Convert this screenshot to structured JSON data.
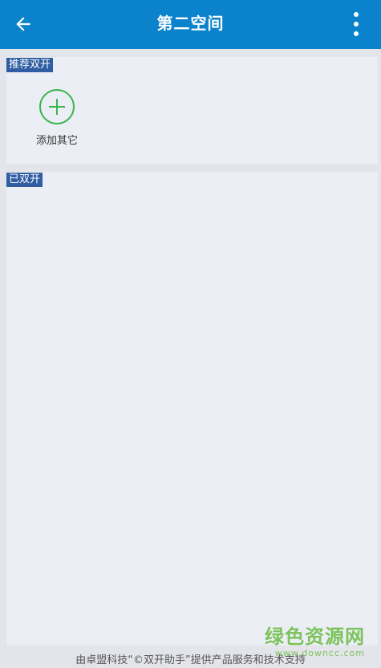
{
  "header": {
    "title": "第二空间",
    "back_icon": "arrow-left-icon",
    "menu_icon": "more-vertical-icon",
    "color": "#0a82cc"
  },
  "sections": {
    "recommend": {
      "label": "推荐双开",
      "items": [
        {
          "label": "添加其它",
          "icon": "plus-circle-icon"
        }
      ]
    },
    "done": {
      "label": "已双开"
    }
  },
  "watermark": {
    "title": "绿色资源网",
    "url": "www.downcc.com"
  },
  "footer": {
    "text": "由卓盟科技“©双开助手”提供产品服务和技术支持"
  }
}
